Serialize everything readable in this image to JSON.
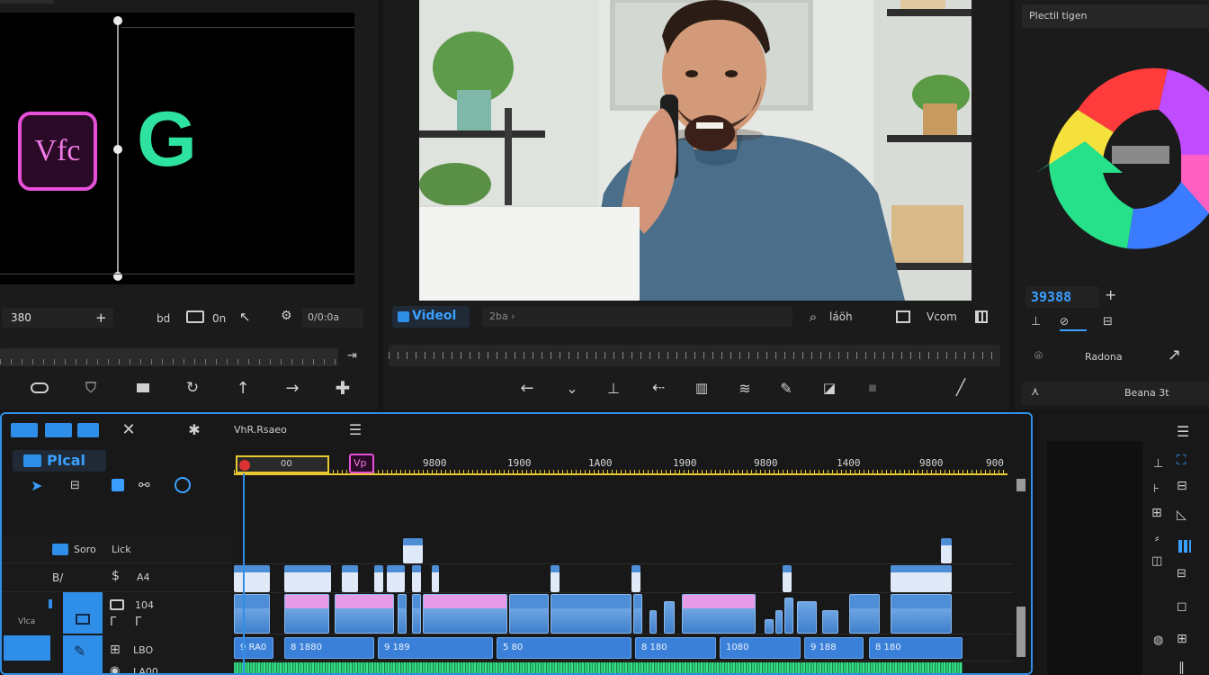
{
  "source_monitor": {
    "logo_text": "Vfc",
    "logo_letter": "G",
    "timecode": "380",
    "toolbar_text1": "bd",
    "toolbar_text2": "0n",
    "toolbar_text3": "0/0:0a"
  },
  "program_monitor": {
    "tab_label": "Videol",
    "breadcrumb": "2ba ›",
    "tool_text1": "láöh",
    "tool_text2": "Vcom"
  },
  "right_panel": {
    "title": "Plectil tigen",
    "value": "39388",
    "row1": "Radona",
    "row2": "Beana 3t",
    "colors": {
      "red": "#ff3b3b",
      "yellow": "#f5e13b",
      "green": "#27e08a",
      "blue": "#3b7bff",
      "purple": "#c04cff",
      "pink": "#ff5fc0"
    }
  },
  "timeline": {
    "header_label": "VhR.Rsaeo",
    "panel_label": "Plcal",
    "playhead_label": "00",
    "marker_label": "Vp",
    "ruler": [
      "9800",
      "1900",
      "1A00",
      "1900",
      "9800",
      "1400",
      "9800",
      "900"
    ],
    "tracks": [
      {
        "name": "Soro",
        "extra": "Lick"
      },
      {
        "name": "B/",
        "extra": "A4"
      },
      {
        "name": "",
        "extra": "104"
      },
      {
        "name": "Vlca",
        "extra": "LBO"
      },
      {
        "name": "",
        "extra": "LA00"
      }
    ],
    "audio_clips": [
      "9 RA0",
      "8 1880",
      "9 189",
      "5 80",
      "8 180",
      "1080",
      "9 188",
      "8 180"
    ]
  },
  "accent": "#2f8fe8"
}
